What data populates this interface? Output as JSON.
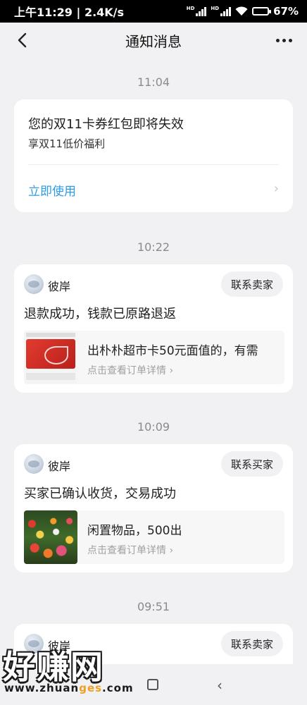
{
  "status_bar": {
    "time": "上午11:29",
    "speed": "2.4K/s",
    "battery": "67%"
  },
  "header": {
    "title": "通知消息"
  },
  "notifications": [
    {
      "time": "11:04",
      "title": "您的双11卡券红包即将失效",
      "subtitle": "享双11低价福利",
      "action": "立即使用"
    },
    {
      "time": "10:22",
      "seller": "彼岸",
      "contact_label": "联系卖家",
      "message": "退款成功，钱款已原路退返",
      "item_title": "出朴朴超市卡50元面值的，有需",
      "item_link": "点击查看订单详情"
    },
    {
      "time": "10:09",
      "seller": "彼岸",
      "contact_label": "联系买家",
      "message": "买家已确认收货，交易成功",
      "item_title": "闲置物品，500出",
      "item_link": "点击查看订单详情"
    },
    {
      "time": "09:51",
      "seller": "彼岸",
      "contact_label": "联系卖家"
    }
  ],
  "watermark": {
    "brand": "好赚网",
    "url_a": "www.zhuan",
    "url_b": "ges",
    "url_c": ".com"
  },
  "colors": {
    "link": "#2e9be6",
    "background": "#f1f1f3",
    "card": "#ffffff"
  }
}
